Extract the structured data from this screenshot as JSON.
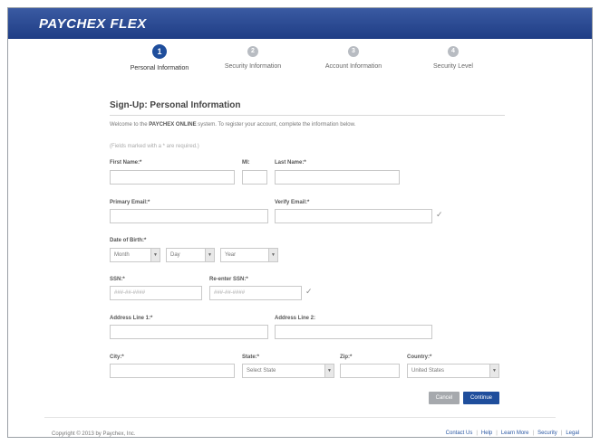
{
  "header": {
    "logo_text": "PAYCHEX FLEX"
  },
  "steps": [
    {
      "number": "1",
      "label": "Personal Information",
      "state": "active"
    },
    {
      "number": "2",
      "label": "Security Information",
      "state": "inactive"
    },
    {
      "number": "3",
      "label": "Account Information",
      "state": "inactive"
    },
    {
      "number": "4",
      "label": "Security Level",
      "state": "inactive"
    }
  ],
  "form": {
    "title": "Sign-Up: Personal Information",
    "intro_prefix": "Welcome to the ",
    "intro_system": "PAYCHEX ONLINE",
    "intro_suffix": " system. To register your account, complete the information below.",
    "required_note": "(Fields marked with a * are required.)",
    "first_name_label": "First Name:*",
    "mi_label": "MI:",
    "last_name_label": "Last Name:*",
    "primary_email_label": "Primary Email:*",
    "verify_email_label": "Verify Email:*",
    "dob_label": "Date of Birth:*",
    "dob_month": "Month",
    "dob_day": "Day",
    "dob_year": "Year",
    "ssn_label": "SSN:*",
    "ssn_placeholder": "###-##-####",
    "reenter_ssn_label": "Re-enter SSN:*",
    "reenter_ssn_placeholder": "###-##-####",
    "address1_label": "Address Line 1:*",
    "address2_label": "Address Line 2:",
    "city_label": "City:*",
    "state_label": "State:*",
    "state_value": "Select State",
    "zip_label": "Zip:*",
    "country_label": "Country:*",
    "country_value": "United States",
    "cancel_label": "Cancel",
    "continue_label": "Continue"
  },
  "footer": {
    "copyright": "Copyright © 2013 by Paychex, Inc.",
    "links": [
      "Contact Us",
      "Help",
      "Learn More",
      "Security",
      "Legal"
    ]
  },
  "colors": {
    "brand_blue": "#1f4e9c",
    "header_blue": "#2c4a92",
    "button_gray": "#a6a9ad"
  }
}
